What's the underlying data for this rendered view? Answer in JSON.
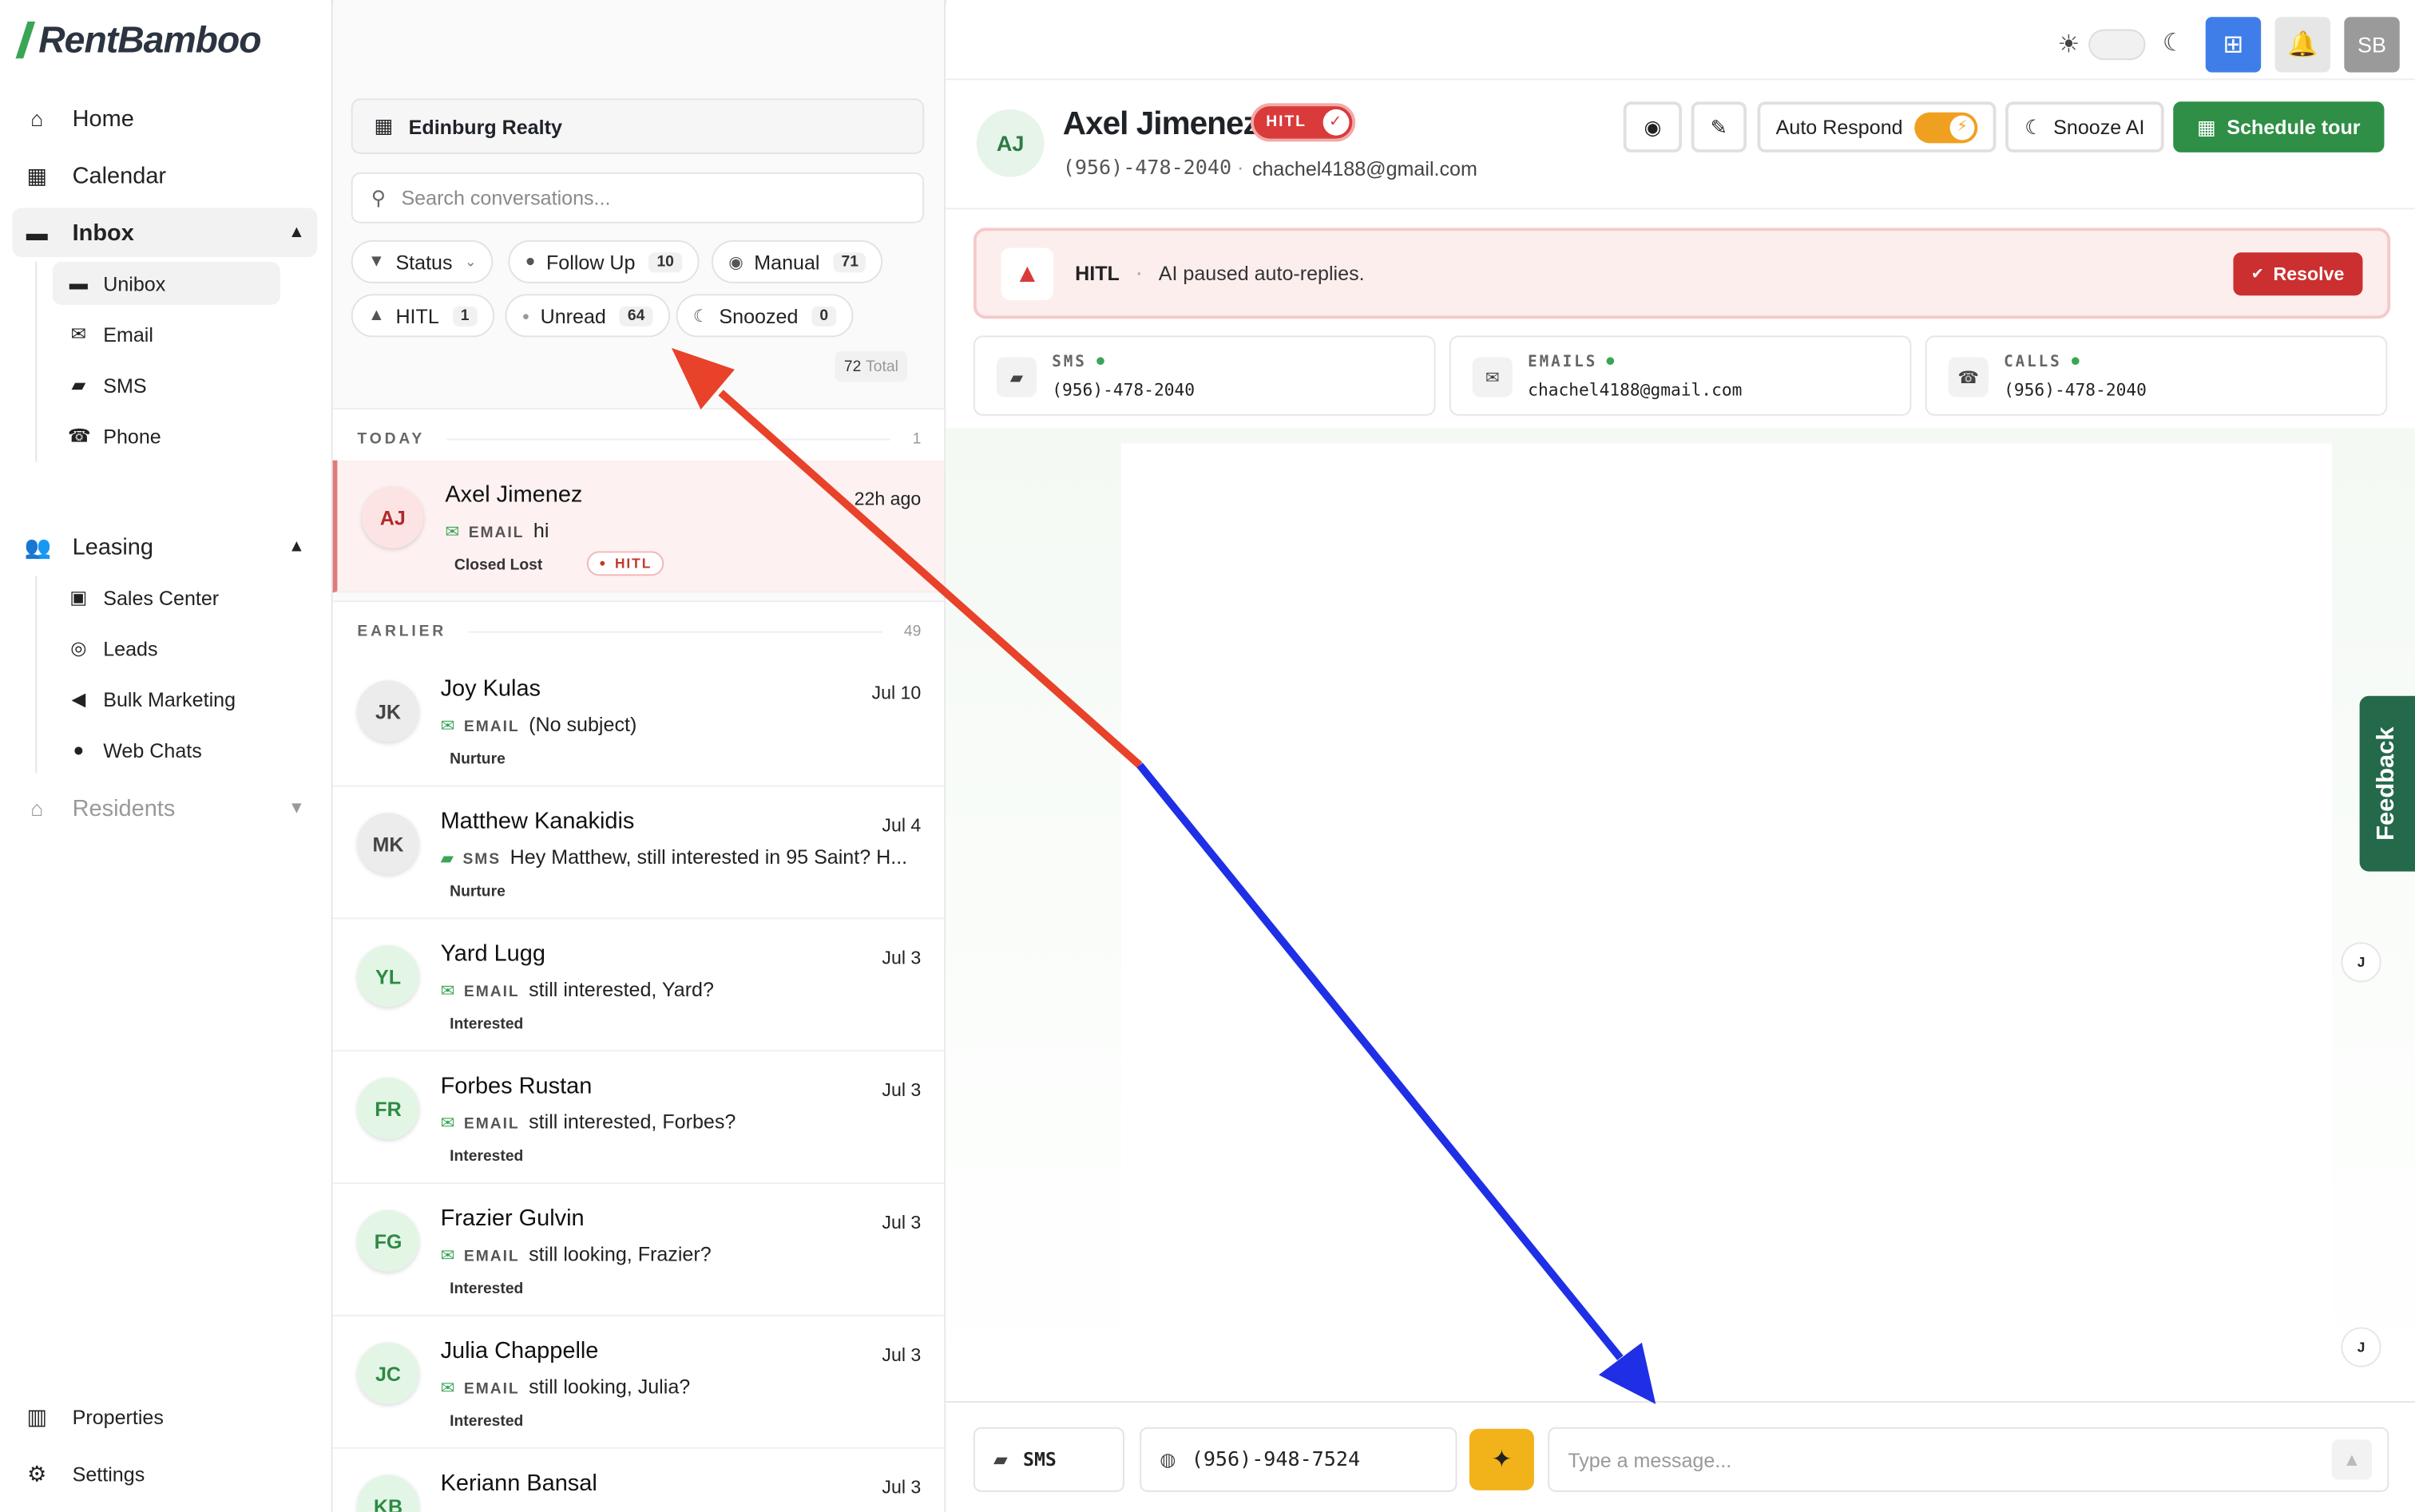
{
  "app": {
    "logo": "RentBamboo",
    "brand_color": "#3aa655"
  },
  "sidebar": {
    "home": "Home",
    "calendar": "Calendar",
    "inbox": "Inbox",
    "inbox_items": [
      "Unibox",
      "Email",
      "SMS",
      "Phone"
    ],
    "leasing": "Leasing",
    "leasing_items": [
      "Sales Center",
      "Leads",
      "Bulk Marketing",
      "Web Chats"
    ],
    "residents": "Residents",
    "properties": "Properties",
    "settings": "Settings"
  },
  "header": {
    "avatar": "SB"
  },
  "list": {
    "property": "Edinburg Realty",
    "search_placeholder": "Search conversations...",
    "filters": {
      "status": "Status",
      "follow_up": "Follow Up",
      "follow_up_count": "10",
      "manual": "Manual",
      "manual_count": "71",
      "hitl": "HITL",
      "hitl_count": "1",
      "unread": "Unread",
      "unread_count": "64",
      "snoozed": "Snoozed",
      "snoozed_count": "0"
    },
    "total_count": "72",
    "total_label": "Total",
    "today_label": "TODAY",
    "today_count": "1",
    "earlier_label": "EARLIER",
    "earlier_count": "49",
    "today_rows": [
      {
        "initials": "AJ",
        "name": "Axel Jimenez",
        "time": "22h ago",
        "channel": "EMAIL",
        "preview": "hi",
        "tag": "Closed Lost",
        "badge": "HITL"
      }
    ],
    "earlier_rows": [
      {
        "initials": "JK",
        "name": "Joy Kulas",
        "time": "Jul 10",
        "channel": "EMAIL",
        "preview": "(No subject)",
        "tag": "Nurture"
      },
      {
        "initials": "MK",
        "name": "Matthew Kanakidis",
        "time": "Jul 4",
        "channel": "SMS",
        "preview": "Hey Matthew, still interested in 95 Saint? H...",
        "tag": "Nurture"
      },
      {
        "initials": "YL",
        "name": "Yard Lugg",
        "time": "Jul 3",
        "channel": "EMAIL",
        "preview": "still interested, Yard?",
        "tag": "Interested"
      },
      {
        "initials": "FR",
        "name": "Forbes Rustan",
        "time": "Jul 3",
        "channel": "EMAIL",
        "preview": "still interested, Forbes?",
        "tag": "Interested"
      },
      {
        "initials": "FG",
        "name": "Frazier Gulvin",
        "time": "Jul 3",
        "channel": "EMAIL",
        "preview": "still looking, Frazier?",
        "tag": "Interested"
      },
      {
        "initials": "JC",
        "name": "Julia Chappelle",
        "time": "Jul 3",
        "channel": "EMAIL",
        "preview": "still looking, Julia?",
        "tag": "Interested"
      },
      {
        "initials": "KB",
        "name": "Keriann Bansal",
        "time": "Jul 3",
        "channel": "",
        "preview": "",
        "tag": ""
      }
    ]
  },
  "contact": {
    "initials": "AJ",
    "name": "Axel Jimenez",
    "hitl": "HITL",
    "phone": "(956)-478-2040",
    "email": "chachel4188@gmail.com",
    "auto_respond": "Auto Respond",
    "snooze": "Snooze AI",
    "schedule": "Schedule tour"
  },
  "banner": {
    "title": "HITL",
    "message": "AI paused auto-replies.",
    "resolve": "Resolve"
  },
  "channels": [
    {
      "label": "SMS",
      "value": "(956)-478-2040"
    },
    {
      "label": "EMAILS",
      "value": "chachel4188@gmail.com"
    },
    {
      "label": "CALLS",
      "value": "(956)-478-2040"
    }
  ],
  "chat": {
    "bubble_initial": "J",
    "feedback": "Feedback"
  },
  "composer": {
    "channel": "SMS",
    "from_number": "(956)-948-7524",
    "placeholder": "Type a message..."
  },
  "annotation_colors": {
    "red": "#e8422a",
    "blue": "#1f2fe6"
  }
}
